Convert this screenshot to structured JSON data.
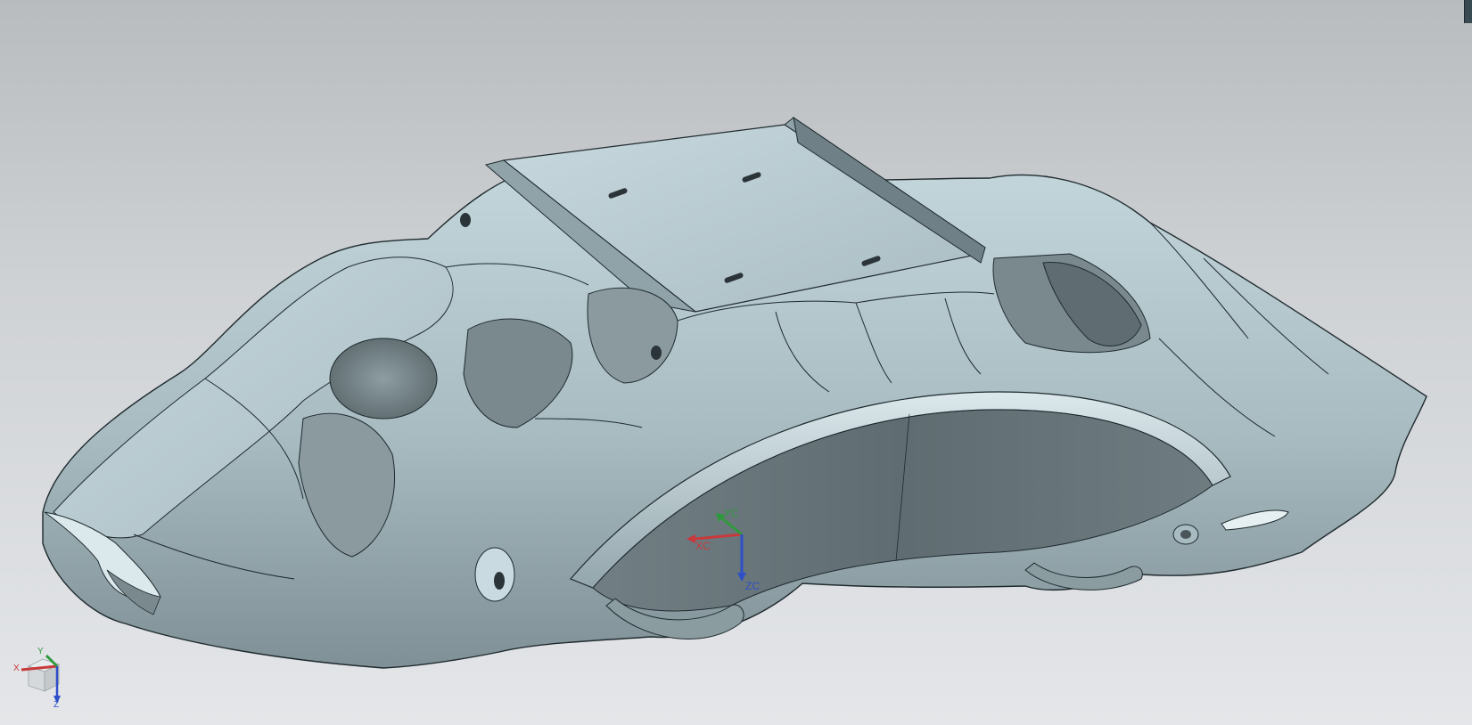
{
  "viewport": {
    "background_top": "#b9bcbf",
    "background_bottom": "#e4e6e9",
    "part_shade_light": "#c9dbe0",
    "part_shade_mid": "#a3b6bc",
    "part_shade_dark": "#6d7c81",
    "edge_color": "#1f2a2e"
  },
  "wcs": {
    "x_label": "XC",
    "y_label": "YC",
    "z_label": "ZC",
    "x_color": "#c8393b",
    "y_color": "#2f9a3b",
    "z_color": "#2e4fc8"
  },
  "triad": {
    "x_label": "X",
    "y_label": "Y",
    "z_label": "Z"
  }
}
